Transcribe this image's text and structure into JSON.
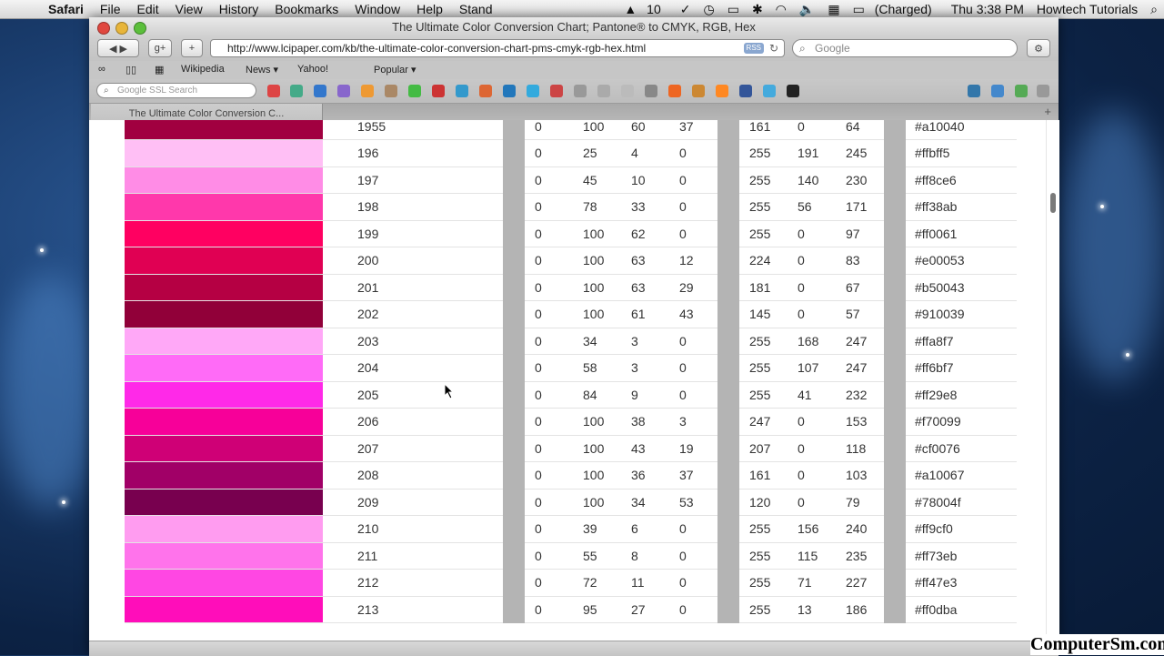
{
  "menubar": {
    "app": "Safari",
    "items": [
      "File",
      "Edit",
      "View",
      "History",
      "Bookmarks",
      "Window",
      "Help",
      "Stand"
    ],
    "status": {
      "adobe_count": "10",
      "battery": "(Charged)",
      "clock": "Thu 3:38 PM",
      "user": "Howtech Tutorials"
    }
  },
  "window": {
    "title": "The Ultimate Color Conversion Chart; Pantone® to CMYK, RGB, Hex",
    "url": "http://www.lcipaper.com/kb/the-ultimate-color-conversion-chart-pms-cmyk-rgb-hex.html",
    "rss": "RSS",
    "search_placeholder": "Google",
    "bookmarks": [
      "Wikipedia",
      "News ▾",
      "Yahoo!",
      "Popular ▾"
    ],
    "ssl_placeholder": "Google SSL Search",
    "tab_title": "The Ultimate Color Conversion C..."
  },
  "rows": [
    {
      "pms": "1955",
      "c": "0",
      "m": "100",
      "y": "60",
      "k": "37",
      "r": "161",
      "g": "0",
      "b": "64",
      "hex": "#a10040"
    },
    {
      "pms": "196",
      "c": "0",
      "m": "25",
      "y": "4",
      "k": "0",
      "r": "255",
      "g": "191",
      "b": "245",
      "hex": "#ffbff5"
    },
    {
      "pms": "197",
      "c": "0",
      "m": "45",
      "y": "10",
      "k": "0",
      "r": "255",
      "g": "140",
      "b": "230",
      "hex": "#ff8ce6"
    },
    {
      "pms": "198",
      "c": "0",
      "m": "78",
      "y": "33",
      "k": "0",
      "r": "255",
      "g": "56",
      "b": "171",
      "hex": "#ff38ab"
    },
    {
      "pms": "199",
      "c": "0",
      "m": "100",
      "y": "62",
      "k": "0",
      "r": "255",
      "g": "0",
      "b": "97",
      "hex": "#ff0061"
    },
    {
      "pms": "200",
      "c": "0",
      "m": "100",
      "y": "63",
      "k": "12",
      "r": "224",
      "g": "0",
      "b": "83",
      "hex": "#e00053"
    },
    {
      "pms": "201",
      "c": "0",
      "m": "100",
      "y": "63",
      "k": "29",
      "r": "181",
      "g": "0",
      "b": "67",
      "hex": "#b50043"
    },
    {
      "pms": "202",
      "c": "0",
      "m": "100",
      "y": "61",
      "k": "43",
      "r": "145",
      "g": "0",
      "b": "57",
      "hex": "#910039"
    },
    {
      "pms": "203",
      "c": "0",
      "m": "34",
      "y": "3",
      "k": "0",
      "r": "255",
      "g": "168",
      "b": "247",
      "hex": "#ffa8f7"
    },
    {
      "pms": "204",
      "c": "0",
      "m": "58",
      "y": "3",
      "k": "0",
      "r": "255",
      "g": "107",
      "b": "247",
      "hex": "#ff6bf7"
    },
    {
      "pms": "205",
      "c": "0",
      "m": "84",
      "y": "9",
      "k": "0",
      "r": "255",
      "g": "41",
      "b": "232",
      "hex": "#ff29e8"
    },
    {
      "pms": "206",
      "c": "0",
      "m": "100",
      "y": "38",
      "k": "3",
      "r": "247",
      "g": "0",
      "b": "153",
      "hex": "#f70099"
    },
    {
      "pms": "207",
      "c": "0",
      "m": "100",
      "y": "43",
      "k": "19",
      "r": "207",
      "g": "0",
      "b": "118",
      "hex": "#cf0076"
    },
    {
      "pms": "208",
      "c": "0",
      "m": "100",
      "y": "36",
      "k": "37",
      "r": "161",
      "g": "0",
      "b": "103",
      "hex": "#a10067"
    },
    {
      "pms": "209",
      "c": "0",
      "m": "100",
      "y": "34",
      "k": "53",
      "r": "120",
      "g": "0",
      "b": "79",
      "hex": "#78004f"
    },
    {
      "pms": "210",
      "c": "0",
      "m": "39",
      "y": "6",
      "k": "0",
      "r": "255",
      "g": "156",
      "b": "240",
      "hex": "#ff9cf0"
    },
    {
      "pms": "211",
      "c": "0",
      "m": "55",
      "y": "8",
      "k": "0",
      "r": "255",
      "g": "115",
      "b": "235",
      "hex": "#ff73eb"
    },
    {
      "pms": "212",
      "c": "0",
      "m": "72",
      "y": "11",
      "k": "0",
      "r": "255",
      "g": "71",
      "b": "227",
      "hex": "#ff47e3"
    },
    {
      "pms": "213",
      "c": "0",
      "m": "95",
      "y": "27",
      "k": "0",
      "r": "255",
      "g": "13",
      "b": "186",
      "hex": "#ff0dba"
    }
  ],
  "watermark": "ComputerSm.com"
}
